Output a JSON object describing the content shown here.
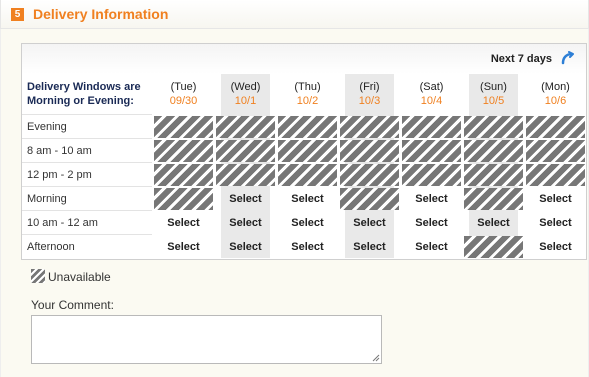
{
  "section": {
    "step_number": "5",
    "title": "Delivery Information"
  },
  "grid": {
    "next_days_label": "Next 7 days",
    "legend_title": "Delivery Windows are Morning or Evening:",
    "days": [
      {
        "name": "(Tue)",
        "date": "09/30"
      },
      {
        "name": "(Wed)",
        "date": "10/1"
      },
      {
        "name": "(Thu)",
        "date": "10/2"
      },
      {
        "name": "(Fri)",
        "date": "10/3"
      },
      {
        "name": "(Sat)",
        "date": "10/4"
      },
      {
        "name": "(Sun)",
        "date": "10/5"
      },
      {
        "name": "(Mon)",
        "date": "10/6"
      }
    ],
    "rows": [
      {
        "label": "Evening",
        "cells": [
          "unavailable",
          "unavailable",
          "unavailable",
          "unavailable",
          "unavailable",
          "unavailable",
          "unavailable"
        ]
      },
      {
        "label": "8 am - 10 am",
        "cells": [
          "unavailable",
          "unavailable",
          "unavailable",
          "unavailable",
          "unavailable",
          "unavailable",
          "unavailable"
        ]
      },
      {
        "label": "12 pm - 2 pm",
        "cells": [
          "unavailable",
          "unavailable",
          "unavailable",
          "unavailable",
          "unavailable",
          "unavailable",
          "unavailable"
        ]
      },
      {
        "label": "Morning",
        "cells": [
          "unavailable",
          "Select",
          "Select",
          "unavailable",
          "Select",
          "unavailable",
          "Select"
        ]
      },
      {
        "label": "10 am - 12 am",
        "cells": [
          "Select",
          "Select",
          "Select",
          "Select",
          "Select",
          "Select",
          "Select"
        ]
      },
      {
        "label": "Afternoon",
        "cells": [
          "Select",
          "Select",
          "Select",
          "Select",
          "Select",
          "unavailable",
          "Select"
        ]
      }
    ]
  },
  "legend": {
    "unavailable_label": "Unavailable"
  },
  "comment": {
    "label": "Your Comment:",
    "value": ""
  },
  "colors": {
    "accent": "#f08020",
    "heading_blue": "#1a2a55",
    "hatch": "#777777"
  }
}
